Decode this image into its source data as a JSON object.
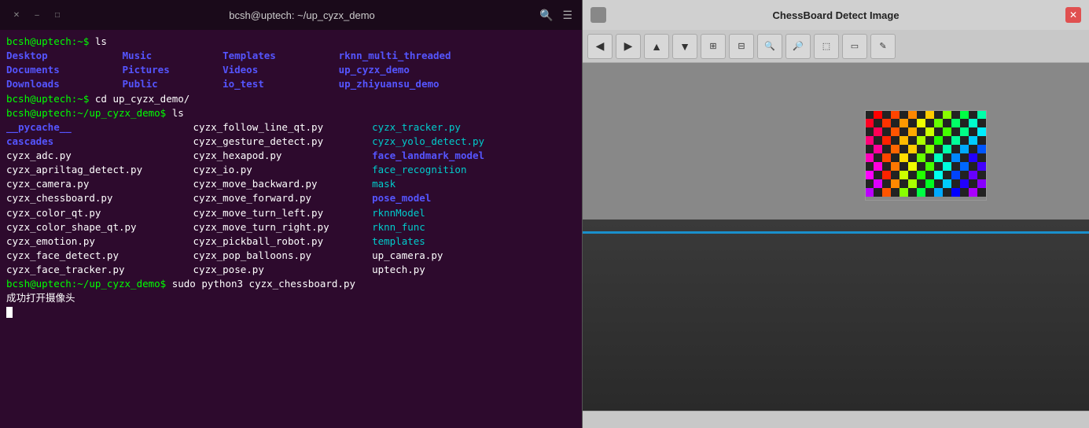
{
  "terminal": {
    "title": "bcsh@uptech: ~/up_cyzx_demo",
    "prompt_user": "bcsh@uptech",
    "lines": [
      {
        "type": "prompt_cmd",
        "prompt": "bcsh@uptech:~$ ",
        "cmd": "ls"
      },
      {
        "type": "filelist",
        "cols": [
          {
            "name": "Desktop",
            "color": "dir-blue"
          },
          {
            "name": "Music",
            "color": "dir-blue"
          },
          {
            "name": "Templates",
            "color": "dir-blue"
          },
          {
            "name": "rknn_multi_threaded",
            "color": "dir-blue"
          }
        ]
      },
      {
        "type": "filelist",
        "cols": [
          {
            "name": "Documents",
            "color": "dir-blue"
          },
          {
            "name": "Pictures",
            "color": "dir-blue"
          },
          {
            "name": "Videos",
            "color": "dir-blue"
          },
          {
            "name": "up_cyzx_demo",
            "color": "dir-blue"
          }
        ]
      },
      {
        "type": "filelist",
        "cols": [
          {
            "name": "Downloads",
            "color": "dir-blue"
          },
          {
            "name": "Public",
            "color": "dir-blue"
          },
          {
            "name": "io_test",
            "color": "dir-blue"
          },
          {
            "name": "up_zhiyuansu_demo",
            "color": "dir-blue"
          }
        ]
      },
      {
        "type": "prompt_cmd",
        "prompt": "bcsh@uptech:~$ ",
        "cmd": "cd up_cyzx_demo/"
      },
      {
        "type": "prompt_cmd",
        "prompt": "bcsh@uptech:~/up_cyzx_demo$ ",
        "cmd": "ls"
      },
      {
        "type": "filelist2",
        "cols": [
          {
            "name": "__pycache__",
            "color": "dir-blue"
          },
          {
            "name": "cyzx_follow_line_qt.py",
            "color": "file-white"
          },
          {
            "name": "cyzx_tracker.py",
            "color": "file-cyan"
          }
        ]
      },
      {
        "type": "filelist2",
        "cols": [
          {
            "name": "cascades",
            "color": "dir-blue"
          },
          {
            "name": "cyzx_gesture_detect.py",
            "color": "file-white"
          },
          {
            "name": "cyzx_yolo_detect.py",
            "color": "file-cyan"
          }
        ]
      },
      {
        "type": "filelist2",
        "cols": [
          {
            "name": "cyzx_adc.py",
            "color": "file-white"
          },
          {
            "name": "cyzx_hexapod.py",
            "color": "file-white"
          },
          {
            "name": "face_landmark_model",
            "color": "dir-blue"
          }
        ]
      },
      {
        "type": "filelist2",
        "cols": [
          {
            "name": "cyzx_apriltag_detect.py",
            "color": "file-white"
          },
          {
            "name": "cyzx_io.py",
            "color": "file-white"
          },
          {
            "name": "face_recognition",
            "color": "file-cyan"
          }
        ]
      },
      {
        "type": "filelist2",
        "cols": [
          {
            "name": "cyzx_camera.py",
            "color": "file-white"
          },
          {
            "name": "cyzx_move_backward.py",
            "color": "file-white"
          },
          {
            "name": "mask",
            "color": "file-cyan"
          }
        ]
      },
      {
        "type": "filelist2",
        "cols": [
          {
            "name": "cyzx_chessboard.py",
            "color": "file-white"
          },
          {
            "name": "cyzx_move_forward.py",
            "color": "file-white"
          },
          {
            "name": "pose_model",
            "color": "dir-blue"
          }
        ]
      },
      {
        "type": "filelist2",
        "cols": [
          {
            "name": "cyzx_color_qt.py",
            "color": "file-white"
          },
          {
            "name": "cyzx_move_turn_left.py",
            "color": "file-white"
          },
          {
            "name": "rknnModel",
            "color": "file-cyan"
          }
        ]
      },
      {
        "type": "filelist2",
        "cols": [
          {
            "name": "cyzx_color_shape_qt.py",
            "color": "file-white"
          },
          {
            "name": "cyzx_move_turn_right.py",
            "color": "file-white"
          },
          {
            "name": "rknn_func",
            "color": "file-cyan"
          }
        ]
      },
      {
        "type": "filelist2",
        "cols": [
          {
            "name": "cyzx_emotion.py",
            "color": "file-white"
          },
          {
            "name": "cyzx_pickball_robot.py",
            "color": "file-white"
          },
          {
            "name": "templates",
            "color": "file-cyan"
          }
        ]
      },
      {
        "type": "filelist2",
        "cols": [
          {
            "name": "cyzx_face_detect.py",
            "color": "file-white"
          },
          {
            "name": "cyzx_pop_balloons.py",
            "color": "file-white"
          },
          {
            "name": "up_camera.py",
            "color": "file-white"
          }
        ]
      },
      {
        "type": "filelist2",
        "cols": [
          {
            "name": "cyzx_face_tracker.py",
            "color": "file-white"
          },
          {
            "name": "cyzx_pose.py",
            "color": "file-white"
          },
          {
            "name": "uptech.py",
            "color": "file-white"
          }
        ]
      },
      {
        "type": "prompt_cmd",
        "prompt": "bcsh@uptech:~/up_cyzx_demo$ ",
        "cmd": "sudo python3 cyzx_chessboard.py"
      },
      {
        "type": "text",
        "text": "成功打开摄像头",
        "color": "success-text"
      },
      {
        "type": "cursor"
      }
    ]
  },
  "chess_window": {
    "title": "ChessBoard Detect Image",
    "toolbar_buttons": [
      {
        "icon": "◀",
        "label": "back"
      },
      {
        "icon": "▶",
        "label": "forward"
      },
      {
        "icon": "▲",
        "label": "up"
      },
      {
        "icon": "▼",
        "label": "down"
      },
      {
        "icon": "⊞",
        "label": "grid"
      },
      {
        "icon": "⊟",
        "label": "grid2"
      },
      {
        "icon": "🔍+",
        "label": "zoom-in"
      },
      {
        "icon": "🔍-",
        "label": "zoom-out"
      },
      {
        "icon": "⬚",
        "label": "fit"
      },
      {
        "icon": "▭",
        "label": "window"
      },
      {
        "icon": "✎",
        "label": "edit"
      }
    ]
  }
}
